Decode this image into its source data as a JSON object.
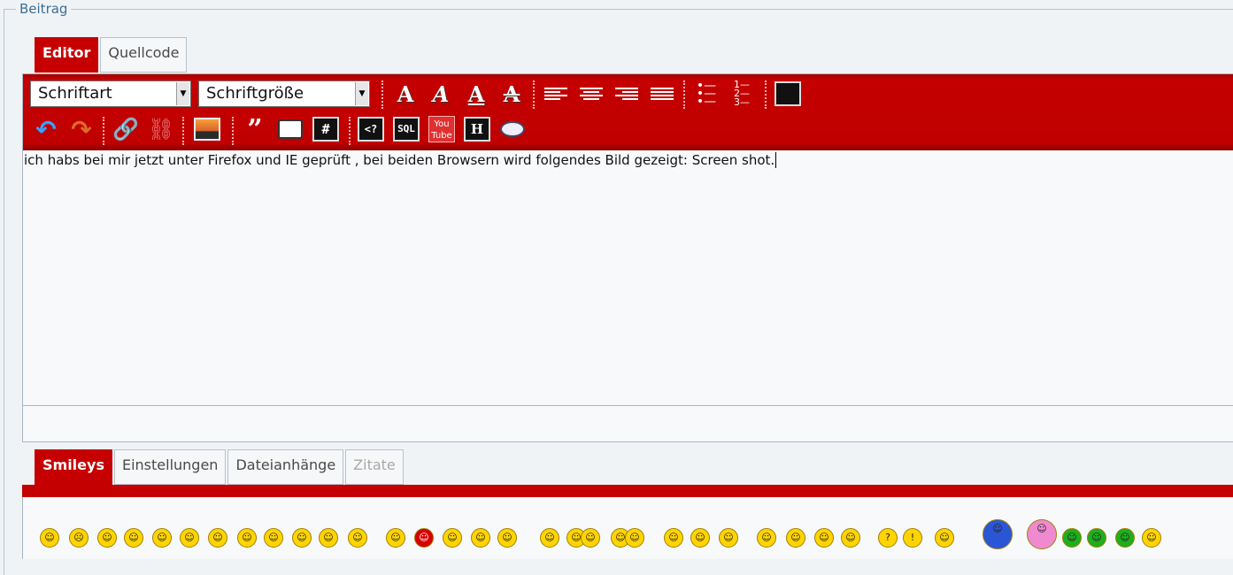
{
  "fieldset": {
    "legend": "Beitrag"
  },
  "editor_tabs": [
    {
      "label": "Editor",
      "active": true
    },
    {
      "label": "Quellcode",
      "active": false
    }
  ],
  "toolbar": {
    "font_select": "Schriftart",
    "size_select": "Schriftgröße",
    "buttons_row1": [
      "bold-icon",
      "italic-icon",
      "underline-icon",
      "strikethrough-icon",
      "align-left-icon",
      "align-center-icon",
      "align-right-icon",
      "justify-icon",
      "bullet-list-icon",
      "numbered-list-icon",
      "color-picker-icon"
    ],
    "buttons_row2": [
      "undo-icon",
      "redo-icon",
      "link-icon",
      "unlink-icon",
      "image-icon",
      "quote-icon",
      "spoiler-icon",
      "hash-icon",
      "code-icon",
      "sql-icon",
      "youtube-icon",
      "heading-icon",
      "paste-icon"
    ],
    "labels": {
      "quote": "”",
      "hash": "#",
      "code": "<?",
      "sql": "SQL",
      "heading": "H",
      "youtube": "You Tube"
    }
  },
  "content": {
    "text": "ich habs bei mir jetzt unter Firefox und IE geprüft , bei beiden Browsern wird folgendes Bild gezeigt: Screen shot."
  },
  "bottom_tabs": [
    {
      "label": "Smileys",
      "active": true
    },
    {
      "label": "Einstellungen",
      "active": false
    },
    {
      "label": "Dateianhänge",
      "active": false
    },
    {
      "label": "Zitate",
      "active": false,
      "disabled": true
    }
  ],
  "smileys": [
    "☺",
    "☹",
    "☺",
    "☺",
    "☺",
    "☺",
    "☺",
    "☺",
    "☺",
    "☺",
    "☺",
    "☺",
    "☺",
    "☺",
    "☺",
    "☺",
    "☺",
    "☺",
    "☺",
    "☺",
    "☺",
    "☺",
    "☺",
    "☺",
    "☺",
    "☺",
    "☺",
    "☺",
    "☺",
    "?",
    "!",
    "☺",
    "☺",
    "☺",
    "☺",
    "☺",
    "☺",
    "☺",
    "☺"
  ],
  "colors": {
    "accent": "#c60000",
    "legend": "#3c6e96"
  }
}
